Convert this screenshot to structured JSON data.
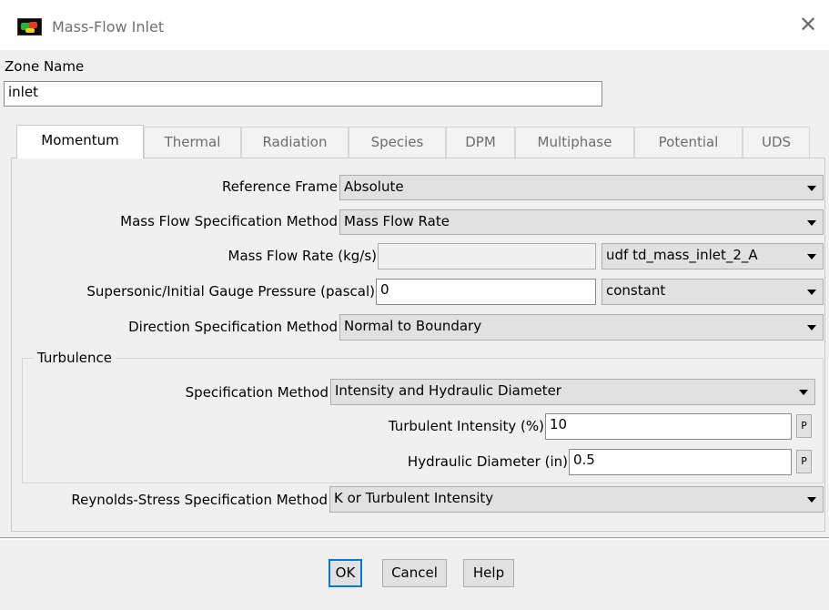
{
  "window": {
    "title": "Mass-Flow Inlet",
    "app_icon": "fluent-app-icon",
    "close_glyph": "✕"
  },
  "zone": {
    "label": "Zone Name",
    "value": "inlet"
  },
  "tabs": [
    {
      "label": "Momentum",
      "active": true
    },
    {
      "label": "Thermal",
      "active": false
    },
    {
      "label": "Radiation",
      "active": false
    },
    {
      "label": "Species",
      "active": false
    },
    {
      "label": "DPM",
      "active": false
    },
    {
      "label": "Multiphase",
      "active": false
    },
    {
      "label": "Potential",
      "active": false
    },
    {
      "label": "UDS",
      "active": false
    }
  ],
  "momentum": {
    "reference_frame": {
      "label": "Reference Frame",
      "value": "Absolute"
    },
    "mass_flow_method": {
      "label": "Mass Flow Specification Method",
      "value": "Mass Flow Rate"
    },
    "mass_flow_rate": {
      "label": "Mass Flow Rate (kg/s)",
      "value": "",
      "profile": "udf td_mass_inlet_2_A"
    },
    "gauge_pressure": {
      "label": "Supersonic/Initial Gauge Pressure (pascal)",
      "value": "0",
      "profile": "constant"
    },
    "direction_method": {
      "label": "Direction Specification Method",
      "value": "Normal to Boundary"
    },
    "turbulence": {
      "title": "Turbulence",
      "spec_method": {
        "label": "Specification Method",
        "value": "Intensity and Hydraulic Diameter"
      },
      "intensity": {
        "label": "Turbulent Intensity (%)",
        "value": "10",
        "p_label": "P"
      },
      "hydraulic_diameter": {
        "label": "Hydraulic Diameter (in)",
        "value": "0.5",
        "p_label": "P"
      }
    },
    "reynolds_stress": {
      "label": "Reynolds-Stress Specification Method",
      "value": "K or Turbulent Intensity"
    }
  },
  "buttons": {
    "ok": "OK",
    "cancel": "Cancel",
    "help": "Help"
  },
  "colors": {
    "default_button_border": "#0078d7",
    "dialog_background": "#f0f0f0"
  }
}
